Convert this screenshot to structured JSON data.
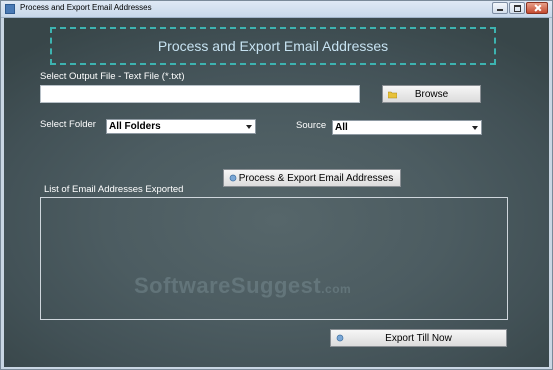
{
  "window": {
    "title": "Process and Export Email Addresses"
  },
  "header": {
    "title": "Process and Export Email Addresses"
  },
  "output": {
    "label": "Select Output File -  Text File  (*.txt)",
    "value": "",
    "browse_label": "Browse"
  },
  "folder": {
    "label": "Select Folder",
    "selected": "All Folders"
  },
  "source": {
    "label": "Source",
    "selected": "All"
  },
  "process_button_label": "Process & Export Email Addresses",
  "list": {
    "label": "List of Email Addresses Exported"
  },
  "export_button_label": "Export Till Now",
  "watermark": {
    "name": "SoftwareSuggest",
    "suffix": ".com"
  }
}
